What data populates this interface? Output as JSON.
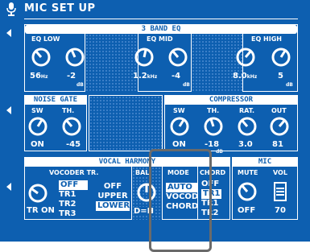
{
  "window": {
    "title": "MIC SET UP"
  },
  "eq": {
    "header": "3 BAND EQ",
    "low": {
      "label": "EQ LOW",
      "freq": "56",
      "freq_unit": "Hz",
      "gain": "-2",
      "gain_unit": "dB"
    },
    "mid": {
      "label": "EQ MID",
      "freq": "1.2",
      "freq_unit": "kHz",
      "gain": "-4",
      "gain_unit": "dB"
    },
    "high": {
      "label": "EQ HIGH",
      "freq": "8.0",
      "freq_unit": "kHz",
      "gain": "5",
      "gain_unit": "dB"
    }
  },
  "noise_gate": {
    "header": "NOISE GATE",
    "sw_label": "SW",
    "th_label": "TH.",
    "sw_value": "ON",
    "th_value": "-45",
    "th_unit": "dB"
  },
  "compressor": {
    "header": "COMPRESSOR",
    "sw_label": "SW",
    "th_label": "TH.",
    "rat_label": "RAT.",
    "out_label": "OUT",
    "sw_value": "ON",
    "th_value": "-18",
    "th_unit": "dB",
    "rat_value": "3.0",
    "out_value": "81"
  },
  "vocal_harmony": {
    "header": "VOCAL HARMONY",
    "vocoder_label": "VOCODER TR.",
    "vocoder_value": "TR ON",
    "tr_options": [
      "OFF",
      "TR1",
      "TR2",
      "TR3"
    ],
    "tr_selected": "OFF",
    "harm_options": [
      "OFF",
      "UPPER",
      "LOWER"
    ],
    "harm_selected": "LOWER",
    "bal_label": "BAL.",
    "bal_value": "D=H",
    "mode_label": "MODE",
    "mode_options": [
      "AUTO",
      "VOCOD",
      "CHORD"
    ],
    "mode_selected": "AUTO",
    "chord_label": "CHORD",
    "chord_options": [
      "OFF",
      "TR1",
      "TR1",
      "TR2"
    ],
    "chord_selected": "TR1"
  },
  "mic": {
    "header": "MIC",
    "mute_label": "MUTE",
    "mute_value": "OFF",
    "vol_label": "VOL",
    "vol_value": "70"
  },
  "colors": {
    "screen": "#0d5fb0",
    "text": "#ffffff",
    "highlight_box": "#6a6a6a"
  }
}
